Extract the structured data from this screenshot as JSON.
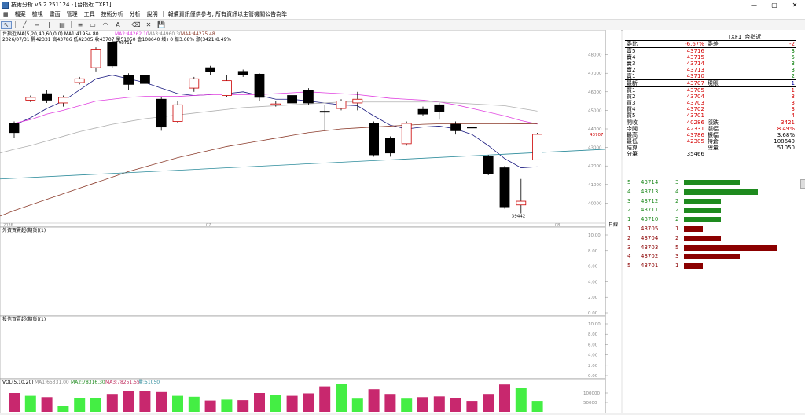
{
  "window": {
    "title": "技術分析 v5.2.251124 - [台指近 TXF1]",
    "controls": [
      "—",
      "▢",
      "✕"
    ]
  },
  "menu": [
    "檔案",
    "檢視",
    "畫面",
    "管理",
    "工具",
    "技術分析",
    "分析",
    "說明",
    "報價資訊僅供參考, 所有資訊以主管機關公告為準"
  ],
  "toolbar_icons": [
    {
      "name": "pointer-icon",
      "glyph": "↖"
    },
    {
      "name": "line-tool-icon",
      "glyph": "╱"
    },
    {
      "name": "hline-tool-icon",
      "glyph": "═"
    },
    {
      "name": "vline-tool-icon",
      "glyph": "‖"
    },
    {
      "name": "channel-tool-icon",
      "glyph": "▤"
    },
    {
      "name": "fib-tool-icon",
      "glyph": "≡"
    },
    {
      "name": "rect-tool-icon",
      "glyph": "▭"
    },
    {
      "name": "arc-tool-icon",
      "glyph": "◠"
    },
    {
      "name": "text-tool-icon",
      "glyph": "A"
    },
    {
      "name": "eraser-icon",
      "glyph": "⌫"
    },
    {
      "name": "delete-icon",
      "glyph": "✕"
    },
    {
      "name": "save-icon",
      "glyph": "💾"
    }
  ],
  "chart": {
    "symbol": "台指近",
    "ma_info": "MA(5,20,40,60,0,0) MA1:41954.80",
    "ma2": "MA2:44262.10",
    "ma3": "MA3:44960.30",
    "ma4": "MA4:44275.48",
    "ohlc": "2026/07/31 開42331 高43786 低42305 收43707 量51050 倉108640 增+0 振3.68% 漲(3421)8.49%",
    "hi_label": "48711",
    "lo_label": "39442",
    "last_price_label": "43707",
    "price_ticks": [
      "48000",
      "47000",
      "46000",
      "45000",
      "44000",
      "43000",
      "42000",
      "41000",
      "40000"
    ],
    "date_ticks": [
      "2026",
      "07",
      "08"
    ],
    "date_axis_label": "日線",
    "panel2_title": "外資買賣超(期貨)(1)",
    "panel3_title": "投信買賣超(期貨)(1)",
    "panel_ticks": [
      "10.00",
      "8.00",
      "6.00",
      "4.00",
      "2.00",
      "0.00"
    ],
    "vol_title": "VOL(5,10,20)",
    "vol_ma1": "MA1:65331.00",
    "vol_ma2": "MA2:78316.30",
    "vol_ma3": "MA3:78251.55",
    "vol_val": "量:51050",
    "vol_ticks": [
      "100000",
      "50000"
    ]
  },
  "chart_data": {
    "type": "candlestick",
    "candles": [
      {
        "o": 43800,
        "c": 44300,
        "h": 44400,
        "l": 43500,
        "up": false
      },
      {
        "o": 45550,
        "c": 45700,
        "h": 45800,
        "l": 45450,
        "up": true
      },
      {
        "o": 45900,
        "c": 45550,
        "h": 46100,
        "l": 45400,
        "up": false
      },
      {
        "o": 45400,
        "c": 45700,
        "h": 45800,
        "l": 45200,
        "up": true
      },
      {
        "o": 46500,
        "c": 46700,
        "h": 46800,
        "l": 46400,
        "up": true
      },
      {
        "o": 47300,
        "c": 48300,
        "h": 48400,
        "l": 47100,
        "up": true
      },
      {
        "o": 48650,
        "c": 47400,
        "h": 48711,
        "l": 47300,
        "up": false
      },
      {
        "o": 46900,
        "c": 46400,
        "h": 47000,
        "l": 46100,
        "up": false
      },
      {
        "o": 46900,
        "c": 46450,
        "h": 47000,
        "l": 46300,
        "up": false
      },
      {
        "o": 45600,
        "c": 44100,
        "h": 45700,
        "l": 43900,
        "up": false
      },
      {
        "o": 44400,
        "c": 45300,
        "h": 45500,
        "l": 44300,
        "up": true
      },
      {
        "o": 46200,
        "c": 46700,
        "h": 46800,
        "l": 46000,
        "up": true
      },
      {
        "o": 47300,
        "c": 47100,
        "h": 47400,
        "l": 46900,
        "up": false
      },
      {
        "o": 45800,
        "c": 46600,
        "h": 46900,
        "l": 45700,
        "up": true
      },
      {
        "o": 47100,
        "c": 46900,
        "h": 47200,
        "l": 46800,
        "up": false
      },
      {
        "o": 46950,
        "c": 45700,
        "h": 47000,
        "l": 45500,
        "up": false
      },
      {
        "o": 45300,
        "c": 45350,
        "h": 45500,
        "l": 45200,
        "up": true
      },
      {
        "o": 45800,
        "c": 45400,
        "h": 46000,
        "l": 45300,
        "up": false
      },
      {
        "o": 46100,
        "c": 45400,
        "h": 46200,
        "l": 45300,
        "up": false
      },
      {
        "o": 44900,
        "c": 44950,
        "h": 45300,
        "l": 43900,
        "up": false
      },
      {
        "o": 45100,
        "c": 45500,
        "h": 45600,
        "l": 45000,
        "up": true
      },
      {
        "o": 45400,
        "c": 45600,
        "h": 46000,
        "l": 45000,
        "up": true
      },
      {
        "o": 44300,
        "c": 42600,
        "h": 44400,
        "l": 42500,
        "up": false
      },
      {
        "o": 43500,
        "c": 42700,
        "h": 43600,
        "l": 42500,
        "up": false
      },
      {
        "o": 43200,
        "c": 44300,
        "h": 44400,
        "l": 43100,
        "up": true
      },
      {
        "o": 45050,
        "c": 44800,
        "h": 45200,
        "l": 44700,
        "up": false
      },
      {
        "o": 45300,
        "c": 44950,
        "h": 45400,
        "l": 44500,
        "up": false
      },
      {
        "o": 44250,
        "c": 43900,
        "h": 44400,
        "l": 43700,
        "up": false
      },
      {
        "o": 44100,
        "c": 44050,
        "h": 44150,
        "l": 43400,
        "up": false
      },
      {
        "o": 42500,
        "c": 41600,
        "h": 42600,
        "l": 41500,
        "up": false
      },
      {
        "o": 41900,
        "c": 39800,
        "h": 42000,
        "l": 39700,
        "up": false
      },
      {
        "o": 40100,
        "c": 39900,
        "h": 41300,
        "l": 39442,
        "up": true
      },
      {
        "o": 42331,
        "c": 43707,
        "h": 43786,
        "l": 42305,
        "up": true
      }
    ],
    "ma_lines": [
      {
        "name": "MA1",
        "color": "#1a1a80",
        "values": [
          44200,
          44600,
          45100,
          45500,
          46100,
          46700,
          46900,
          46700,
          46500,
          46200,
          45900,
          45800,
          45850,
          45900,
          46000,
          45800,
          45600,
          45600,
          45500,
          45400,
          45300,
          45250,
          44700,
          44200,
          44000,
          44100,
          44150,
          44000,
          43700,
          43100,
          42400,
          41900,
          41954
        ]
      },
      {
        "name": "MA2",
        "color": "#e040e0",
        "values": [
          44300,
          44500,
          44800,
          45000,
          45250,
          45500,
          45600,
          45700,
          45750,
          45750,
          45750,
          45800,
          45850,
          45850,
          45850,
          45850,
          45900,
          45950,
          46000,
          45950,
          45900,
          45850,
          45750,
          45650,
          45600,
          45550,
          45450,
          45300,
          45100,
          44900,
          44700,
          44450,
          44262
        ]
      },
      {
        "name": "MA3",
        "color": "#b0b0b0",
        "values": [
          42900,
          43100,
          43350,
          43600,
          43850,
          44050,
          44250,
          44400,
          44550,
          44650,
          44750,
          44850,
          44950,
          45050,
          45150,
          45200,
          45250,
          45300,
          45350,
          45400,
          45450,
          45450,
          45450,
          45450,
          45450,
          45450,
          45450,
          45400,
          45350,
          45300,
          45250,
          45100,
          44960
        ]
      },
      {
        "name": "MA4",
        "color": "#8b3a2a",
        "values": [
          39600,
          39900,
          40200,
          40500,
          40800,
          41100,
          41400,
          41700,
          41950,
          42200,
          42450,
          42650,
          42850,
          43050,
          43200,
          43350,
          43500,
          43650,
          43800,
          43900,
          44000,
          44050,
          44100,
          44150,
          44200,
          44250,
          44275,
          44280,
          44280,
          44280,
          44280,
          44278,
          44275
        ]
      },
      {
        "name": "trend",
        "color": "#2a8a9a",
        "values": [
          41300,
          41350,
          41400,
          41450,
          41500,
          41550,
          41600,
          41650,
          41700,
          41750,
          41800,
          41850,
          41900,
          41950,
          42000,
          42050,
          42100,
          42150,
          42200,
          42250,
          42300,
          42350,
          42400,
          42450,
          42500,
          42550,
          42600,
          42650,
          42700,
          42750,
          42800,
          42850,
          42900
        ]
      }
    ],
    "volume": [
      100000,
      85000,
      78000,
      30000,
      75000,
      72000,
      95000,
      110000,
      110000,
      105000,
      85000,
      80000,
      60000,
      65000,
      62000,
      100000,
      90000,
      85000,
      98000,
      135000,
      150000,
      70000,
      120000,
      95000,
      70000,
      78000,
      82000,
      75000,
      58000,
      95000,
      145000,
      125000,
      58000
    ],
    "volume_up": [
      false,
      true,
      false,
      true,
      true,
      true,
      false,
      false,
      false,
      false,
      true,
      true,
      false,
      true,
      false,
      false,
      true,
      false,
      false,
      false,
      true,
      true,
      false,
      false,
      true,
      false,
      false,
      false,
      false,
      false,
      false,
      true,
      true
    ],
    "ylim": [
      39000,
      49000
    ],
    "panel_ylim": [
      0,
      10
    ],
    "vol_ylim": [
      0,
      150000
    ]
  },
  "quote": {
    "header": {
      "code": "TXF1",
      "name": "台指近"
    },
    "rows": [
      {
        "a": "委比",
        "b": "-6.67%",
        "c": "委差",
        "d": "-2",
        "bc": "red",
        "dc": "red"
      },
      {
        "a": "賣5",
        "b": "43716",
        "c": "",
        "d": "3",
        "bc": "red",
        "dc": "grn"
      },
      {
        "a": "賣4",
        "b": "43715",
        "c": "",
        "d": "5",
        "bc": "red",
        "dc": "grn"
      },
      {
        "a": "賣3",
        "b": "43714",
        "c": "",
        "d": "3",
        "bc": "red",
        "dc": "grn"
      },
      {
        "a": "賣2",
        "b": "43713",
        "c": "",
        "d": "3",
        "bc": "red",
        "dc": "grn"
      },
      {
        "a": "賣1",
        "b": "43710",
        "c": "",
        "d": "2",
        "bc": "red",
        "dc": "grn"
      },
      {
        "a": "最新",
        "b": "43707",
        "c": "現賬",
        "d": "1",
        "bc": "red",
        "dc": "blu"
      },
      {
        "a": "買1",
        "b": "43705",
        "c": "",
        "d": "1",
        "bc": "red",
        "dc": "red"
      },
      {
        "a": "買2",
        "b": "43704",
        "c": "",
        "d": "3",
        "bc": "red",
        "dc": "red"
      },
      {
        "a": "買3",
        "b": "43703",
        "c": "",
        "d": "3",
        "bc": "red",
        "dc": "red"
      },
      {
        "a": "買4",
        "b": "43702",
        "c": "",
        "d": "3",
        "bc": "red",
        "dc": "red"
      },
      {
        "a": "買5",
        "b": "43701",
        "c": "",
        "d": "4",
        "bc": "red",
        "dc": "red"
      },
      {
        "a": "開收",
        "b": "40286",
        "c": "漲跌",
        "d": "3421",
        "bc": "red",
        "dc": "red"
      },
      {
        "a": "今開",
        "b": "42331",
        "c": "漲幅",
        "d": "8.49%",
        "bc": "red",
        "dc": "red"
      },
      {
        "a": "最高",
        "b": "43786",
        "c": "振幅",
        "d": "3.68%",
        "bc": "red",
        "dc": ""
      },
      {
        "a": "最低",
        "b": "42305",
        "c": "持倉",
        "d": "108640",
        "bc": "red",
        "dc": ""
      },
      {
        "a": "結算",
        "b": "",
        "c": "總量",
        "d": "51050",
        "bc": "",
        "dc": ""
      },
      {
        "a": "分筆",
        "b": "35466",
        "c": "",
        "d": "",
        "bc": "",
        "dc": ""
      }
    ],
    "sell_book": [
      {
        "lvl": "5",
        "px": "43714",
        "qty": "3",
        "q": 3
      },
      {
        "lvl": "4",
        "px": "43713",
        "qty": "4",
        "q": 4
      },
      {
        "lvl": "3",
        "px": "43712",
        "qty": "2",
        "q": 2
      },
      {
        "lvl": "2",
        "px": "43711",
        "qty": "2",
        "q": 2
      },
      {
        "lvl": "1",
        "px": "43710",
        "qty": "2",
        "q": 2
      }
    ],
    "buy_book": [
      {
        "lvl": "1",
        "px": "43705",
        "qty": "1",
        "q": 1
      },
      {
        "lvl": "2",
        "px": "43704",
        "qty": "2",
        "q": 2
      },
      {
        "lvl": "3",
        "px": "43703",
        "qty": "5",
        "q": 5
      },
      {
        "lvl": "4",
        "px": "43702",
        "qty": "3",
        "q": 3
      },
      {
        "lvl": "5",
        "px": "43701",
        "qty": "1",
        "q": 1
      }
    ],
    "colors": {
      "sell": "#1e8a1e",
      "buy": "#8b0000"
    }
  }
}
